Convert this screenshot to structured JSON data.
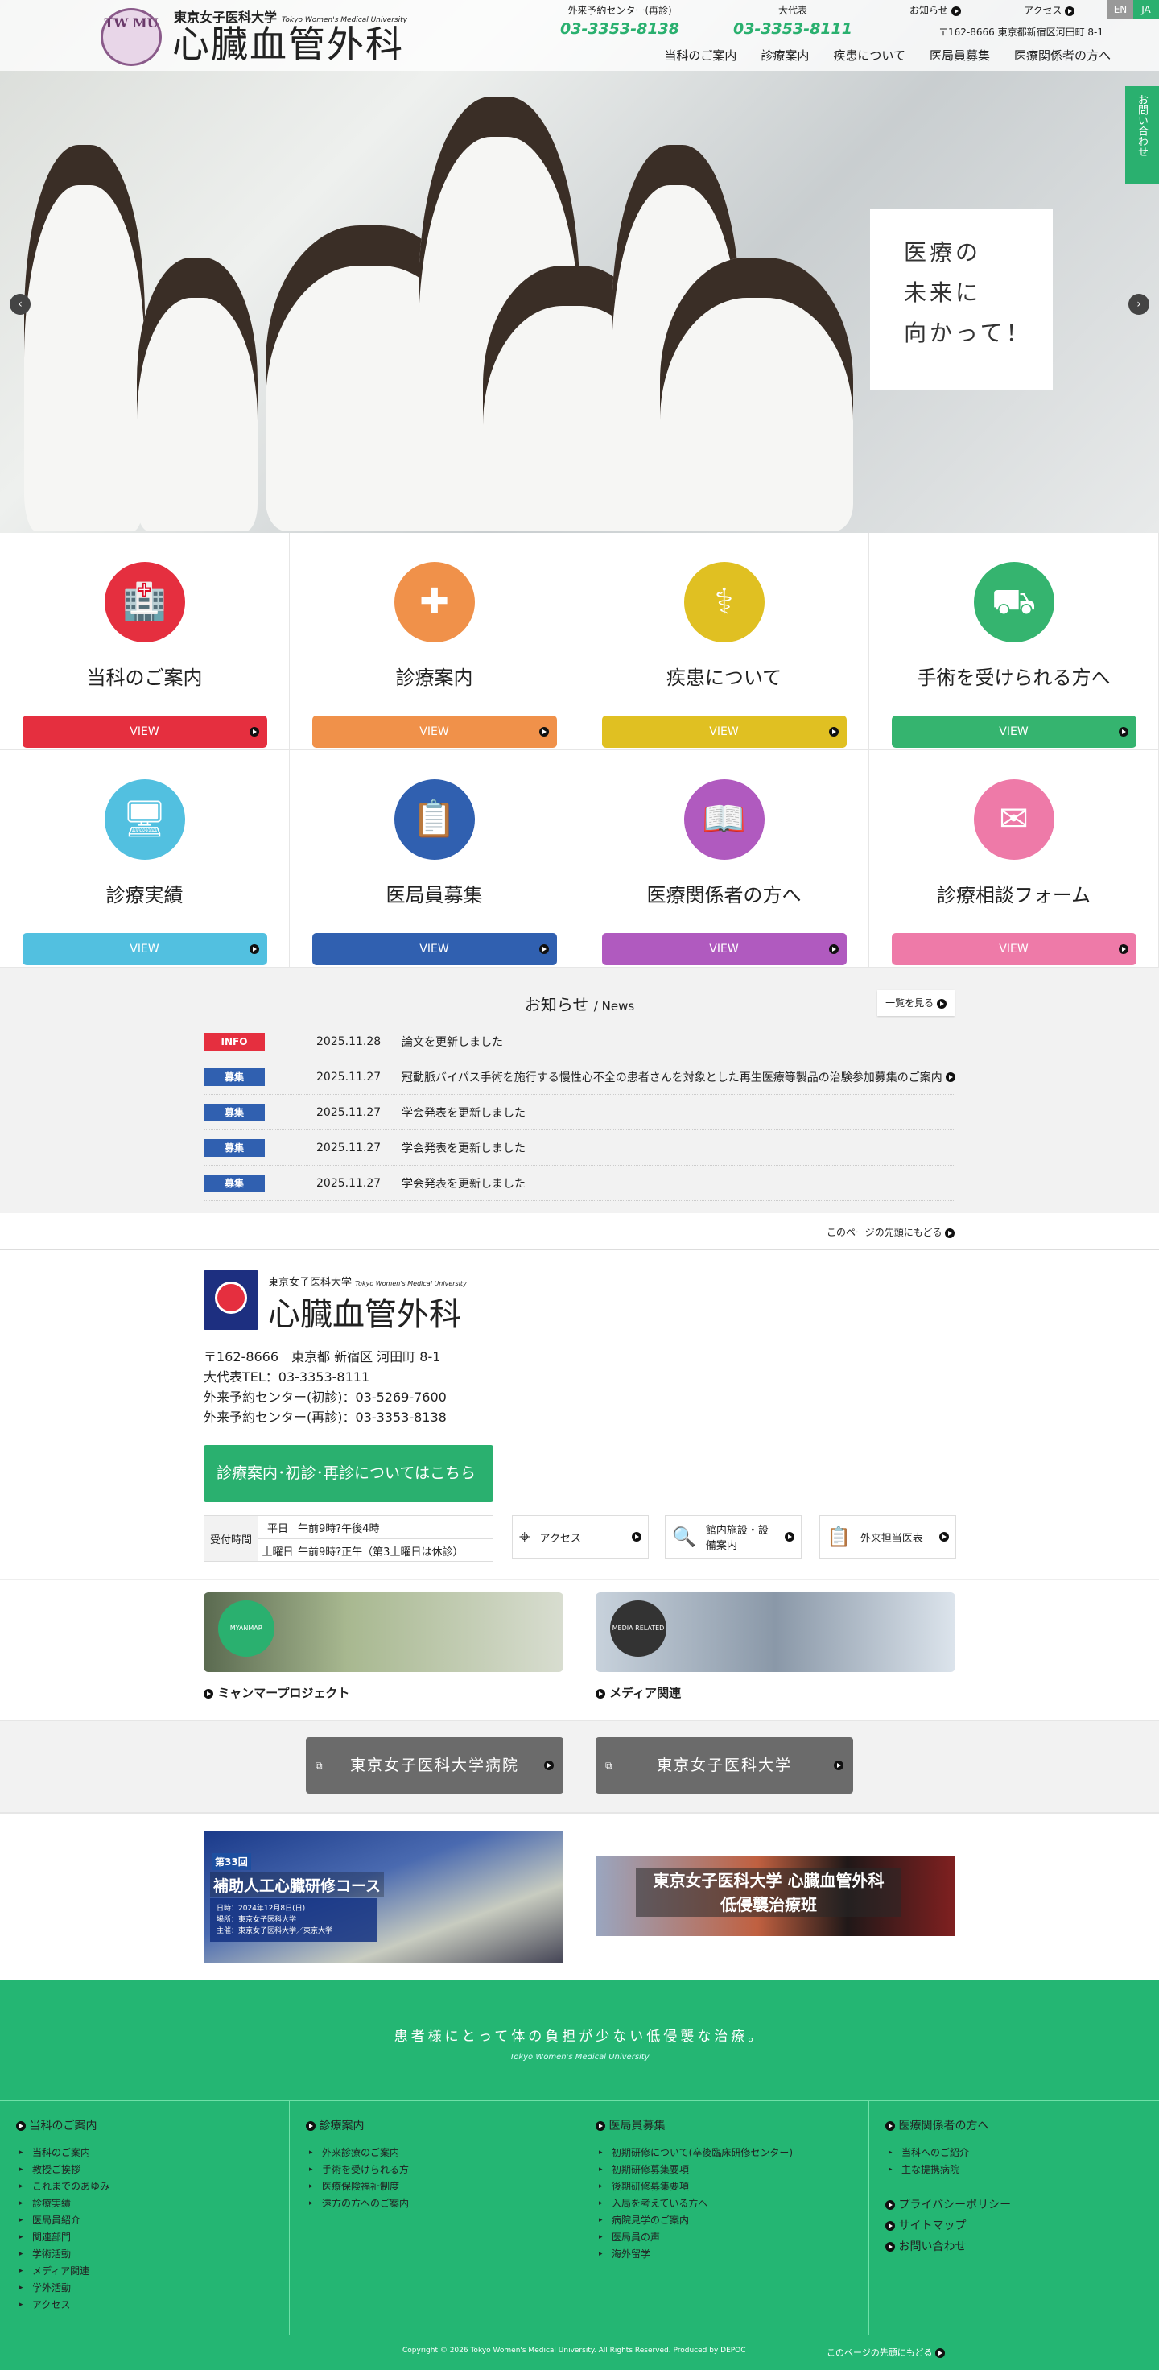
{
  "header": {
    "university": "東京女子医科大学",
    "university_en": "Tokyo Women's Medical University",
    "department": "心臓血管外科",
    "logo_text": "TW MU",
    "contacts": [
      {
        "label": "外来予約センター(再診)",
        "tel": "03-3353-8138"
      },
      {
        "label": "大代表",
        "tel": "03-3353-8111"
      }
    ],
    "links": {
      "news": "お知らせ",
      "access": "アクセス"
    },
    "address": "〒162-8666 東京都新宿区河田町 8-1",
    "lang": {
      "en": "EN",
      "ja": "JA"
    },
    "nav": [
      "当科のご案内",
      "診療案内",
      "疾患について",
      "医局員募集",
      "医療関係者の方へ"
    ]
  },
  "hero": {
    "copy_line1": "医療の",
    "copy_line2": "未来に",
    "copy_line3": "向かって！",
    "contact_tab": "お問い合わせ",
    "prev": "‹",
    "next": "›"
  },
  "cards": [
    {
      "title": "当科のご案内",
      "view": "VIEW",
      "color": "#e52f3f",
      "icon": "hospital-icon",
      "glyph": "🏥"
    },
    {
      "title": "診療案内",
      "view": "VIEW",
      "color": "#f0914a",
      "icon": "medical-bag-icon",
      "glyph": "✚"
    },
    {
      "title": "疾患について",
      "view": "VIEW",
      "color": "#e0c022",
      "icon": "stethoscope-icon",
      "glyph": "⚕"
    },
    {
      "title": "手術を受けられる方へ",
      "view": "VIEW",
      "color": "#35b46f",
      "icon": "stretcher-icon",
      "glyph": "⛟"
    },
    {
      "title": "診療実績",
      "view": "VIEW",
      "color": "#52c0e0",
      "icon": "monitor-icon",
      "glyph": "🖥"
    },
    {
      "title": "医局員募集",
      "view": "VIEW",
      "color": "#3060b0",
      "icon": "clipboard-icon",
      "glyph": "📋"
    },
    {
      "title": "医療関係者の方へ",
      "view": "VIEW",
      "color": "#b05abf",
      "icon": "medical-book-icon",
      "glyph": "📖"
    },
    {
      "title": "診療相談フォーム",
      "view": "VIEW",
      "color": "#ee7aa8",
      "icon": "mail-icon",
      "glyph": "✉"
    }
  ],
  "news": {
    "title": "お知らせ",
    "title_en": "/ News",
    "more": "一覧を見る",
    "items": [
      {
        "badge": "INFO",
        "badge_color": "#e52f3f",
        "date": "2025.11.28",
        "text": "論文を更新しました"
      },
      {
        "badge": "募集",
        "badge_color": "#3060b0",
        "date": "2025.11.27",
        "text": "冠動脈バイパス手術を施行する慢性心不全の患者さんを対象とした再生医療等製品の治験参加募集のご案内"
      },
      {
        "badge": "募集",
        "badge_color": "#3060b0",
        "date": "2025.11.27",
        "text": "学会発表を更新しました"
      },
      {
        "badge": "募集",
        "badge_color": "#3060b0",
        "date": "2025.11.27",
        "text": "学会発表を更新しました"
      },
      {
        "badge": "募集",
        "badge_color": "#3060b0",
        "date": "2025.11.27",
        "text": "学会発表を更新しました"
      }
    ]
  },
  "back_to_top": "このページの先頭にもどる",
  "info": {
    "address": "〒162-8666　東京都 新宿区 河田町 8-1",
    "tel": "大代表TEL：03-3353-8111",
    "first": "外来予約センター(初診)：03-5269-7600",
    "revisit": "外来予約センター(再診)：03-3353-8138",
    "cta": "診療案内･初診･再診についてはこちら",
    "hours": {
      "label": "受付時間",
      "weekday": "平日",
      "weekday_time": "午前9時?午後4時",
      "saturday": "土曜日",
      "saturday_time": "午前9時?正午（第3土曜日は休診）"
    },
    "quick": [
      "アクセス",
      "館内施設・設備案内",
      "外来担当医表"
    ]
  },
  "banners": {
    "myanmar": "ミャンマープロジェクト",
    "media": "メディア関連",
    "myanmar_badge": "MYANMAR PROJECT",
    "media_badge": "MEDIA RELATED"
  },
  "ext_links": [
    "東京女子医科大学病院",
    "東京女子医科大学"
  ],
  "promo": {
    "course_no": "第33回",
    "course": "補助人工心臓研修コース",
    "course_date": "日時：2024年12月8日(日)",
    "course_place": "場所：東京女子医科大学",
    "course_host": "主催：東京女子医科大学／東京大学",
    "team_line1": "東京女子医科大学 心臓血管外科",
    "team_line2": "低侵襲治療班"
  },
  "footer": {
    "tagline": "患者様にとって体の負担が少ない低侵襲な治療。",
    "tagline_en": "Tokyo Women's Medical University",
    "cols": [
      {
        "head": "当科のご案内",
        "items": [
          "当科のご案内",
          "教授ご挨拶",
          "これまでのあゆみ",
          "診療実績",
          "医局員紹介",
          "関連部門",
          "学術活動",
          "メディア関連",
          "学外活動",
          "アクセス"
        ]
      },
      {
        "head": "診療案内",
        "items": [
          "外来診療のご案内",
          "手術を受けられる方",
          "医療保険福祉制度",
          "遠方の方へのご案内"
        ]
      },
      {
        "head": "医局員募集",
        "items": [
          "初期研修について(卒後臨床研修センター)",
          "初期研修募集要項",
          "後期研修募集要項",
          "入局を考えている方へ",
          "病院見学のご案内",
          "医局員の声",
          "海外留学"
        ]
      },
      {
        "head": "医療関係者の方へ",
        "items": [
          "当科へのご紹介",
          "主な提携病院"
        ],
        "extra": [
          "プライバシーポリシー",
          "サイトマップ",
          "お問い合わせ"
        ]
      }
    ],
    "copyright": "Copyright © 2026 Tokyo Women's Medical University. All Rights Reserved. Produced by DEPOC",
    "back_to_top": "このページの先頭にもどる"
  }
}
